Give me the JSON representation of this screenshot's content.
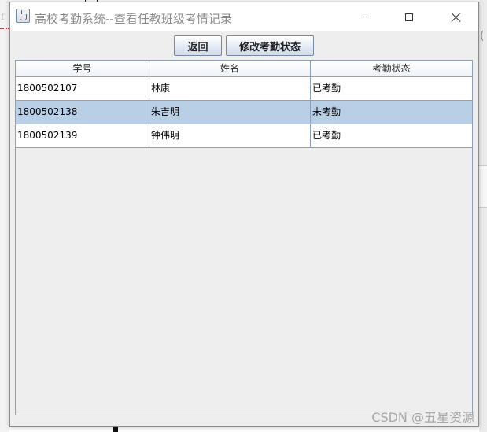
{
  "window": {
    "title": "高校考勤系统--查看任教班级考情记录"
  },
  "toolbar": {
    "back_label": "返回",
    "modify_label": "修改考勤状态"
  },
  "table": {
    "columns": [
      "学号",
      "姓名",
      "考勤状态"
    ],
    "rows": [
      {
        "id": "1800502107",
        "name": "林康",
        "status": "已考勤",
        "selected": false
      },
      {
        "id": "1800502138",
        "name": "朱吉明",
        "status": "未考勤",
        "selected": true
      },
      {
        "id": "1800502139",
        "name": "钟伟明",
        "status": "已考勤",
        "selected": false
      }
    ]
  },
  "colors": {
    "selected_row": "#b8cfe5",
    "grid_line": "#8da0b6",
    "panel_bg": "#eeeeee"
  },
  "watermark": "CSDN @五星资源"
}
